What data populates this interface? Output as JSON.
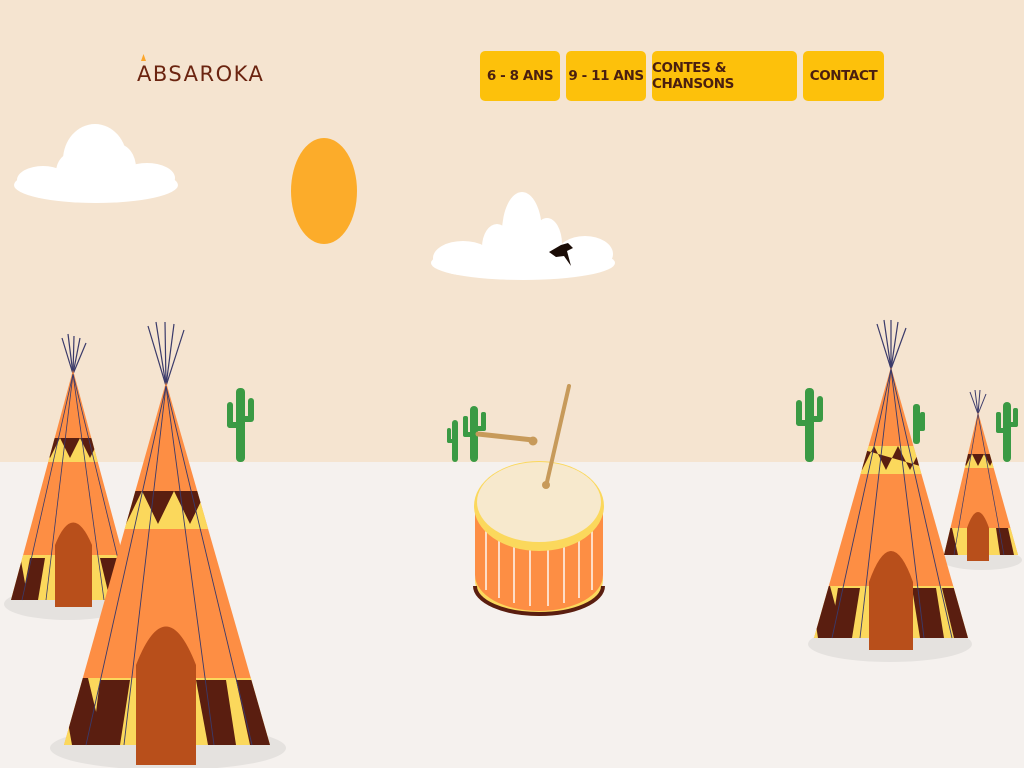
{
  "header": {
    "logo": "ABSAROKA"
  },
  "nav": [
    {
      "label": "6 - 8 ANS"
    },
    {
      "label": "9 - 11 ANS"
    },
    {
      "label": "CONTES & CHANSONS"
    },
    {
      "label": "CONTACT"
    }
  ],
  "colors": {
    "sky": "#f5e4d0",
    "ground": "#f5f1ee",
    "nav_button": "#fdc10b",
    "logo_text": "#6b2410",
    "sun": "#fcac2a",
    "tipi_orange": "#fd8e44",
    "tipi_dark": "#5a1e10",
    "tipi_yellow": "#fbd85c",
    "door": "#b84f1b",
    "cactus": "#3a9a44"
  },
  "icons": {
    "sun": "sun-icon",
    "bird": "bird-icon",
    "cloud": "cloud-icon",
    "cactus": "cactus-icon",
    "tipi": "tipi-icon",
    "drum": "drum-icon"
  }
}
